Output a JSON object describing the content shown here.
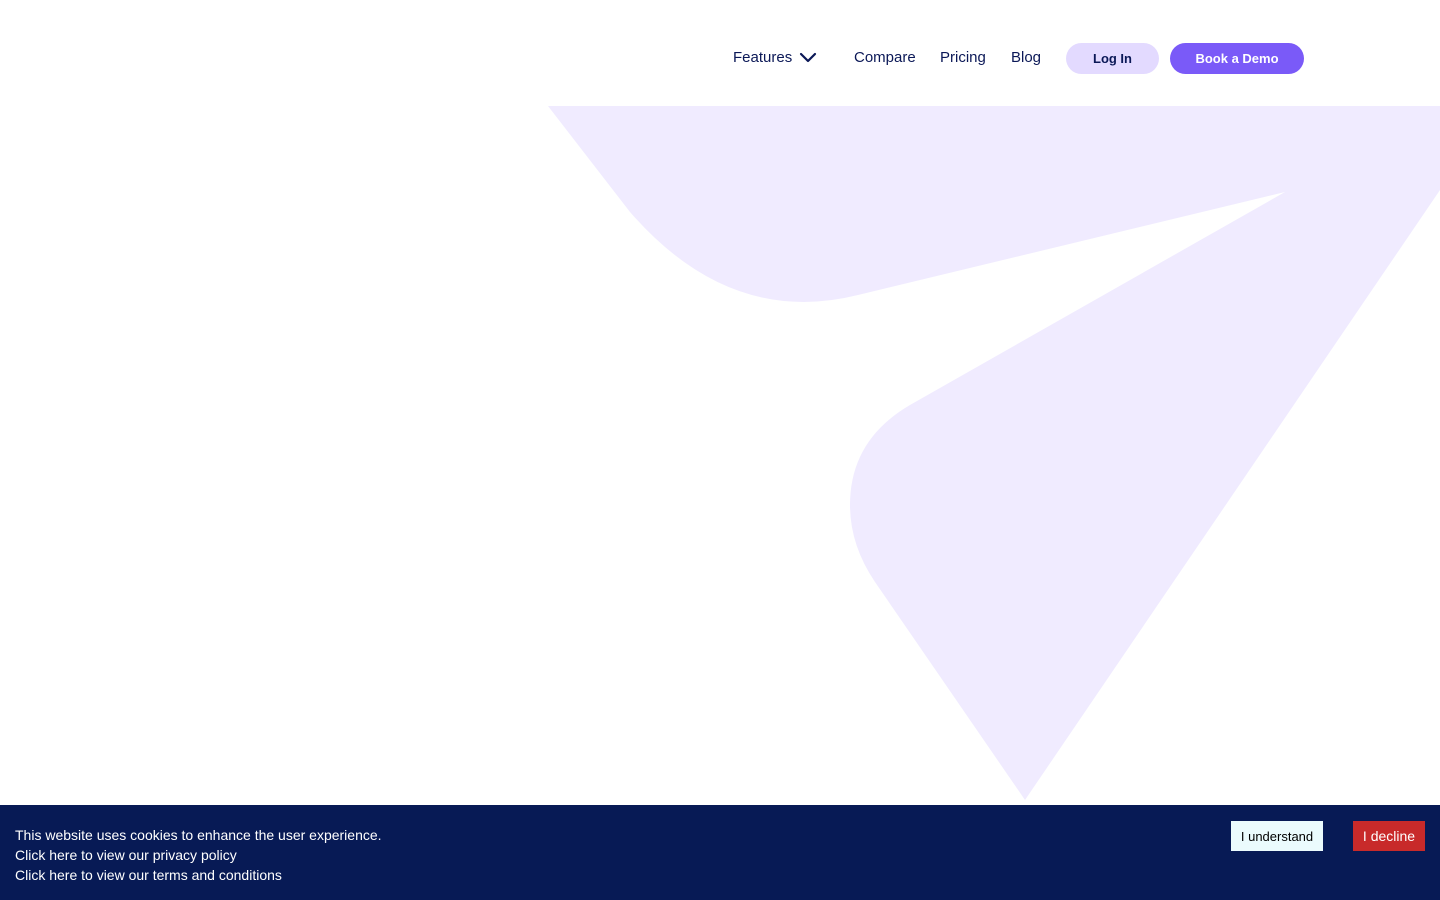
{
  "nav": {
    "features_label": "Features",
    "features_icon": "chevron-down-icon",
    "compare_label": "Compare",
    "pricing_label": "Pricing",
    "blog_label": "Blog",
    "login_label": "Log In",
    "demo_label": "Book a Demo"
  },
  "hero": {
    "shape_color": "#f0ebff"
  },
  "cookie_banner": {
    "message": "This website uses cookies to enhance the user experience.",
    "privacy_link": "Click here to view our privacy policy",
    "terms_link": "Click here to view our terms and conditions",
    "accept_label": "I understand",
    "decline_label": "I decline"
  },
  "colors": {
    "brand": "#7a5af8",
    "navy": "#071a55",
    "text": "#0b1857",
    "login_bg": "#e3daff",
    "decline_bg": "#c82a2a",
    "accept_bg": "#ebfbfd"
  }
}
